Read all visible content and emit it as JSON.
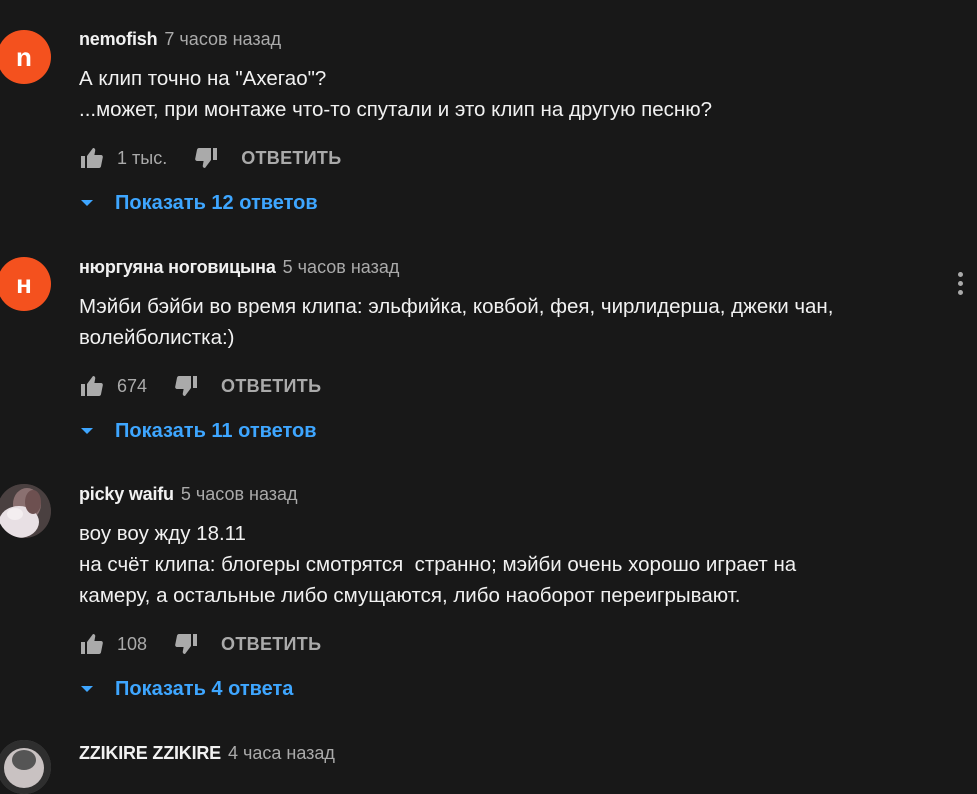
{
  "colors": {
    "background": "#181818",
    "link": "#3ea6ff",
    "secondary_text": "#aaaaaa"
  },
  "comments": [
    {
      "author": "nemofish",
      "time": "7 часов назад",
      "avatar_letter": "n",
      "avatar_color": "#f4511e",
      "lines": [
        "А клип точно на \"Ахегао\"?",
        "...может, при монтаже что-то спутали и это клип на другую песню?"
      ],
      "likes": "1 тыс.",
      "reply_label": "ОТВЕТИТЬ",
      "replies_label": "Показать 12 ответов"
    },
    {
      "author": "нюргуяна ноговицына",
      "time": "5 часов назад",
      "avatar_letter": "н",
      "avatar_color": "#f4511e",
      "lines": [
        "Мэйби бэйби во время клипа: эльфийка, ковбой, фея, чирлидерша, джеки чан,",
        "волейболистка:)"
      ],
      "likes": "674",
      "reply_label": "ОТВЕТИТЬ",
      "replies_label": "Показать 11 ответов"
    },
    {
      "author": "picky waifu",
      "time": "5 часов назад",
      "avatar_letter": "",
      "avatar_color": "#b8a8a8",
      "lines": [
        "воу воу жду 18.11",
        "на счёт клипа: блогеры смотрятся  странно; мэйби очень хорошо играет на",
        "камеру, а остальные либо смущаются, либо наоборот переигрывают."
      ],
      "likes": "108",
      "reply_label": "ОТВЕТИТЬ",
      "replies_label": "Показать 4 ответа"
    },
    {
      "author": "ZZIKIRE ZZIKIRE",
      "time": "4 часа назад",
      "avatar_letter": "",
      "avatar_color": "#5a5a5a"
    }
  ]
}
